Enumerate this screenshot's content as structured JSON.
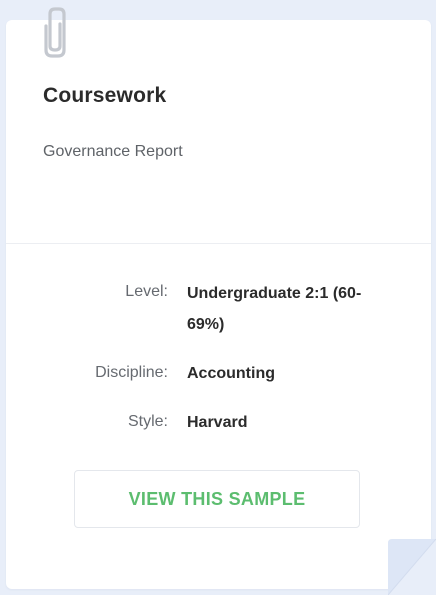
{
  "card": {
    "icon": "paperclip-icon",
    "title": "Coursework",
    "subtitle": "Governance Report"
  },
  "details": {
    "level_label": "Level:",
    "level_value": "Undergraduate 2:1 (60-69%)",
    "discipline_label": "Discipline:",
    "discipline_value": "Accounting",
    "style_label": "Style:",
    "style_value": "Harvard"
  },
  "cta": {
    "label": "VIEW THIS SAMPLE"
  },
  "colors": {
    "page_background": "#e8eef9",
    "card_background": "#ffffff",
    "cta_text": "#5cbd6f",
    "title_text": "#2b2b2b",
    "muted_text": "#666a70",
    "clip_icon": "#c4c8cf",
    "page_curl": "#dde6f6"
  }
}
